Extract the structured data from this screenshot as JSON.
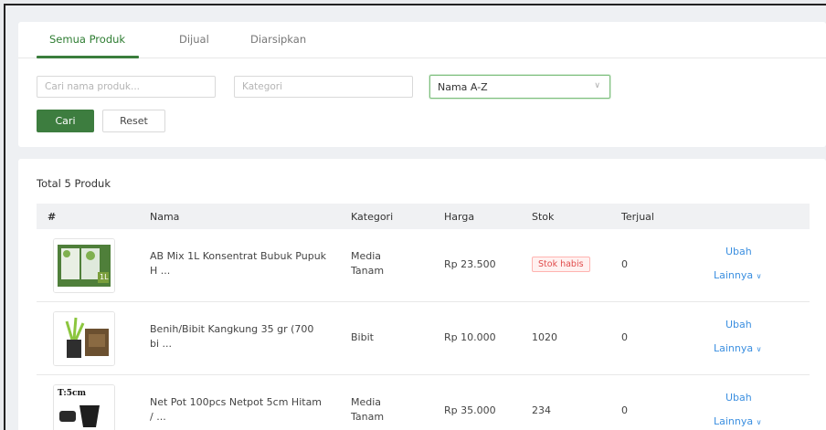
{
  "tabs": [
    {
      "label": "Semua Produk"
    },
    {
      "label": "Dijual"
    },
    {
      "label": "Diarsipkan"
    }
  ],
  "filters": {
    "search_placeholder": "Cari nama produk...",
    "category_placeholder": "Kategori",
    "sort_value": "Nama A-Z",
    "search_button": "Cari",
    "reset_button": "Reset"
  },
  "list": {
    "total_label": "Total 5 Produk",
    "columns": [
      "#",
      "Nama",
      "Kategori",
      "Harga",
      "Stok",
      "Terjual"
    ],
    "edit_label": "Ubah",
    "more_label": "Lainnya",
    "rows": [
      {
        "name_line1": "AB Mix 1L Konsentrat Bubuk Pupuk",
        "name_line2": "H ...",
        "category_line1": "Media",
        "category_line2": "Tanam",
        "price": "Rp 23.500",
        "stock_badge": "Stok habis",
        "sold": "0",
        "thumb_badge": "1L"
      },
      {
        "name_line1": "Benih/Bibit Kangkung 35 gr (700",
        "name_line2": "bi ...",
        "category": "Bibit",
        "price": "Rp 10.000",
        "stock": "1020",
        "sold": "0"
      },
      {
        "name_line1": "Net Pot 100pcs Netpot 5cm Hitam",
        "name_line2": "/ ...",
        "category_line1": "Media",
        "category_line2": "Tanam",
        "price": "Rp 35.000",
        "stock": "234",
        "sold": "0",
        "thumb_text": "T:5cm"
      }
    ]
  },
  "colors": {
    "primary": "#3d7d3f",
    "link": "#3b8fe0",
    "danger": "#e04b4b"
  }
}
